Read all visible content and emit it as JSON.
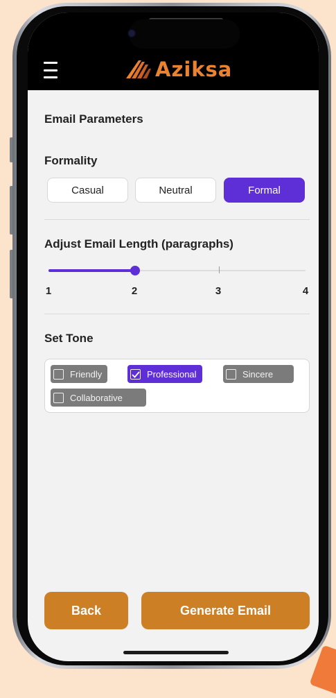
{
  "app": {
    "logo_text": "Aziksa",
    "accent_color": "#5e2ed6",
    "action_color": "#cd7f26",
    "logo_color": "#e9832f"
  },
  "header": {
    "menu_icon": "hamburger-menu-icon"
  },
  "page": {
    "title": "Email Parameters"
  },
  "formality": {
    "label": "Formality",
    "options": [
      "Casual",
      "Neutral",
      "Formal"
    ],
    "selected": "Formal"
  },
  "length": {
    "label": "Adjust Email Length (paragraphs)",
    "ticks": [
      "1",
      "2",
      "3",
      "4"
    ],
    "value": 2
  },
  "tone": {
    "label": "Set Tone",
    "options": [
      {
        "label": "Friendly",
        "checked": false
      },
      {
        "label": "Professional",
        "checked": true
      },
      {
        "label": "Sincere",
        "checked": false
      },
      {
        "label": "Collaborative",
        "checked": false
      }
    ]
  },
  "actions": {
    "back_label": "Back",
    "generate_label": "Generate Email"
  }
}
